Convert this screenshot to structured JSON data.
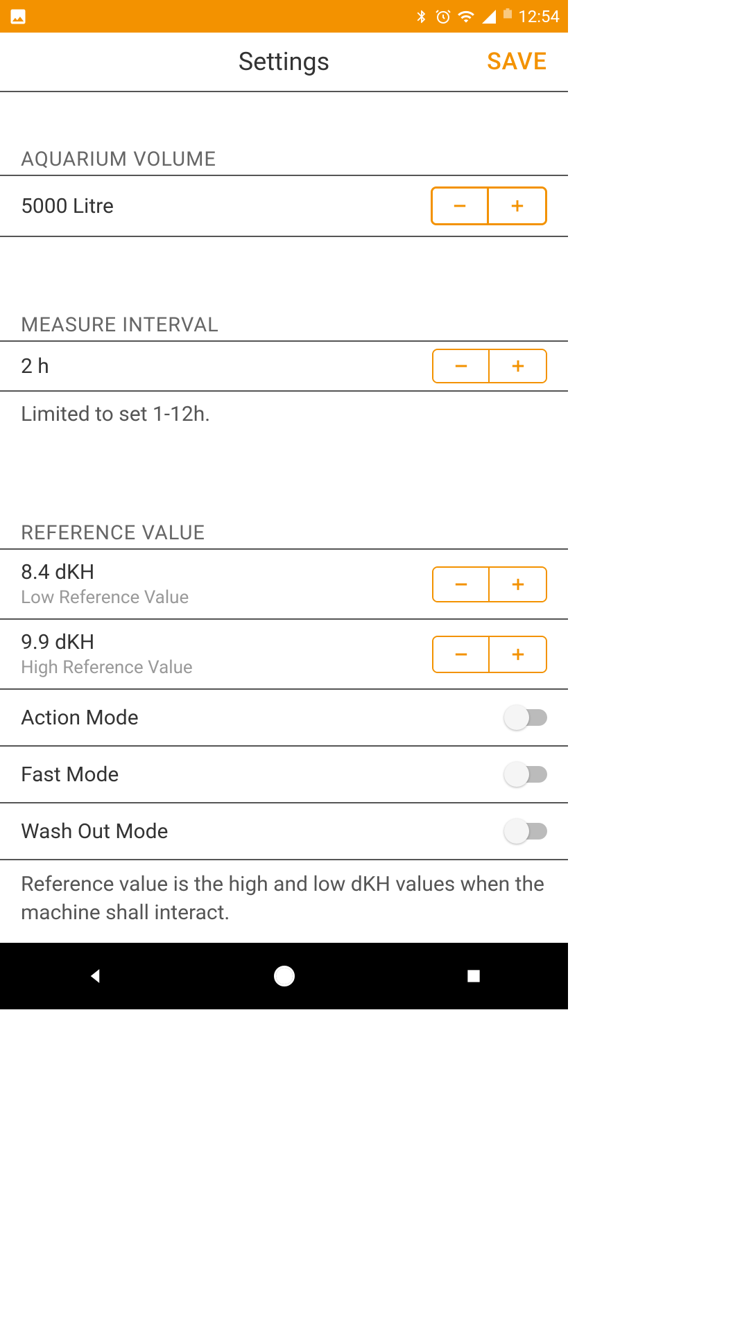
{
  "status": {
    "time": "12:54"
  },
  "header": {
    "title": "Settings",
    "save": "SAVE"
  },
  "aquarium": {
    "header": "AQUARIUM VOLUME",
    "value": "5000 Litre"
  },
  "interval": {
    "header": "MEASURE INTERVAL",
    "value": "2 h",
    "helper": "Limited to set 1-12h."
  },
  "reference": {
    "header": "REFERENCE VALUE",
    "low_value": "8.4 dKH",
    "low_label": "Low Reference Value",
    "high_value": "9.9 dKH",
    "high_label": "High Reference Value",
    "action_mode": "Action Mode",
    "fast_mode": "Fast Mode",
    "wash_out_mode": "Wash Out Mode",
    "footer": "Reference value is the high and low dKH values when the machine shall interact."
  }
}
